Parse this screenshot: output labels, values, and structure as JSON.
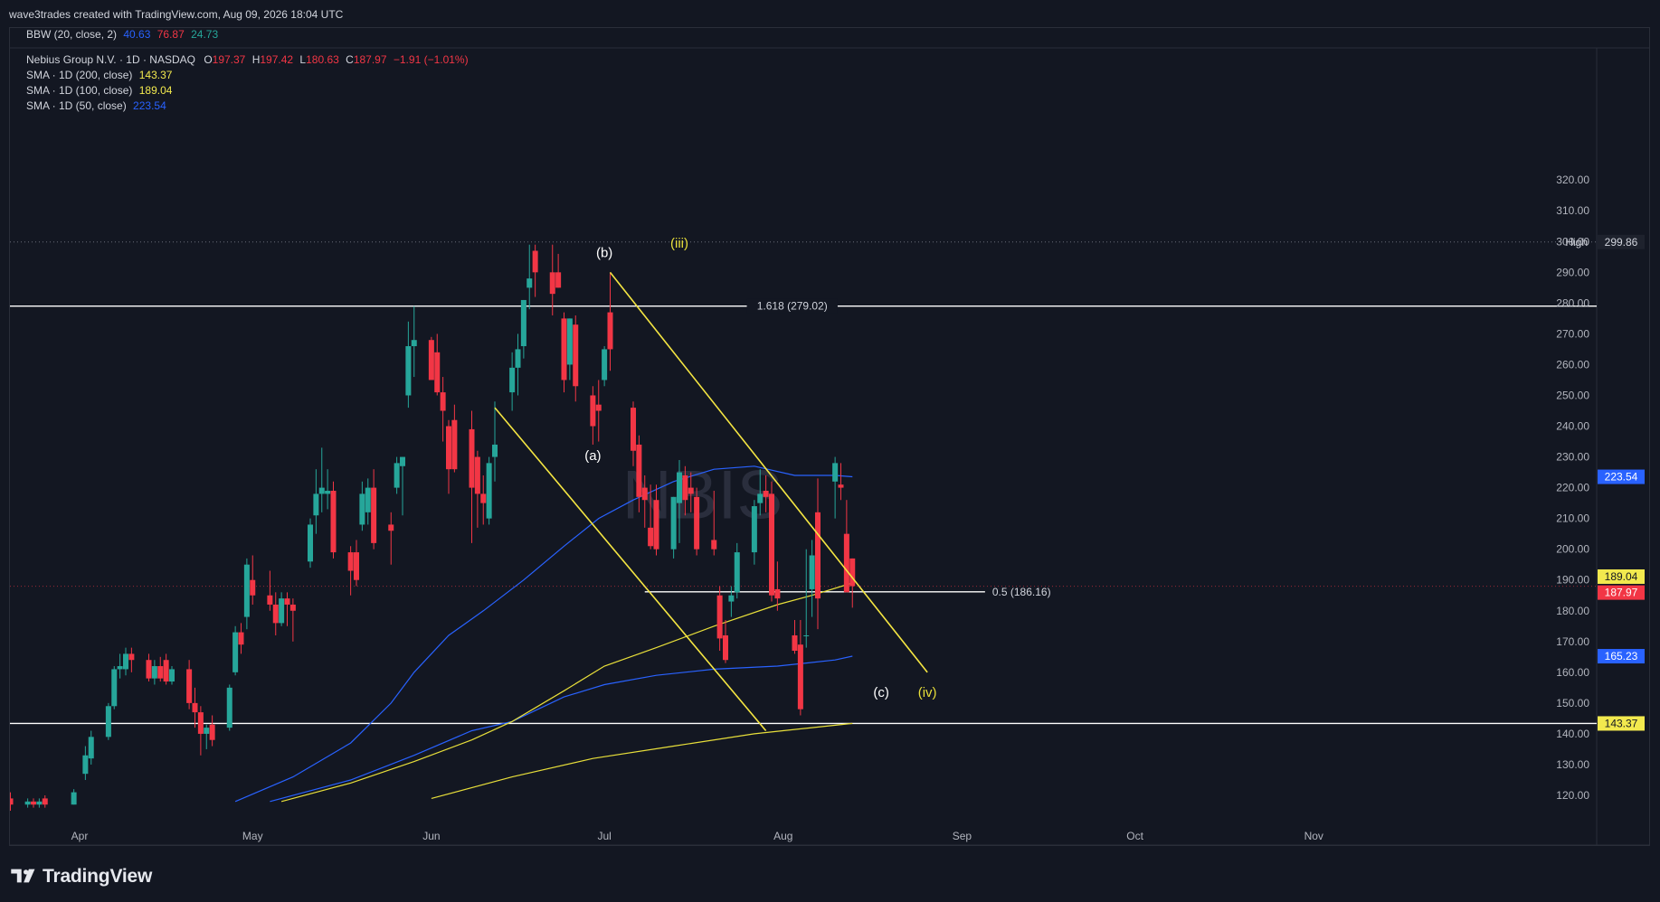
{
  "header": {
    "caption": "wave3trades created with TradingView.com, Aug 09, 2026 18:04 UTC"
  },
  "indicator_bbw": {
    "label": "BBW (20, close, 2)",
    "v1": "40.63",
    "v2": "76.87",
    "v3": "24.73"
  },
  "symbol": {
    "name": "Nebius Group N.V. · 1D · NASDAQ",
    "o_label": "O",
    "o": "197.37",
    "h_label": "H",
    "h": "197.42",
    "l_label": "L",
    "l": "180.63",
    "c_label": "C",
    "c": "187.97",
    "change": "−1.91 (−1.01%)",
    "watermark": "NBIS"
  },
  "sma_legend": [
    {
      "label": "SMA · 1D (200, close)",
      "value": "143.37",
      "color": "#f2e94e"
    },
    {
      "label": "SMA · 1D (100, close)",
      "value": "189.04",
      "color": "#f2e94e"
    },
    {
      "label": "SMA · 1D (50, close)",
      "value": "223.54",
      "color": "#2962ff"
    }
  ],
  "branding": {
    "name": "TradingView"
  },
  "colors": {
    "up": "#26a69a",
    "down": "#f23645",
    "background": "#131722",
    "sma_yellow": "#e8df3a",
    "sma_blue": "#2962ff",
    "channel": "#f5e642",
    "grid_text": "#b2b5be"
  },
  "chart_data": {
    "type": "candlestick",
    "y_range": [
      112,
      326
    ],
    "y_ticks": [
      "120.00",
      "130.00",
      "140.00",
      "150.00",
      "160.00",
      "170.00",
      "180.00",
      "190.00",
      "200.00",
      "210.00",
      "220.00",
      "230.00",
      "240.00",
      "250.00",
      "260.00",
      "270.00",
      "280.00",
      "290.00",
      "300.00",
      "310.00",
      "320.00"
    ],
    "x_labels": [
      {
        "label": "Apr",
        "date": "2026-04-01"
      },
      {
        "label": "May",
        "date": "2026-05-01"
      },
      {
        "label": "Jun",
        "date": "2026-06-01"
      },
      {
        "label": "Jul",
        "date": "2026-07-01"
      },
      {
        "label": "Aug",
        "date": "2026-08-01"
      },
      {
        "label": "Sep",
        "date": "2026-09-01"
      },
      {
        "label": "Oct",
        "date": "2026-10-01"
      },
      {
        "label": "Nov",
        "date": "2026-11-01"
      }
    ],
    "candles": [
      {
        "d": "2026-03-19",
        "o": 121,
        "h": 124,
        "l": 116,
        "c": 119
      },
      {
        "d": "2026-03-20",
        "o": 119,
        "h": 121,
        "l": 115,
        "c": 117
      },
      {
        "d": "2026-03-23",
        "o": 117,
        "h": 119,
        "l": 116,
        "c": 118
      },
      {
        "d": "2026-03-24",
        "o": 118,
        "h": 119,
        "l": 116,
        "c": 117
      },
      {
        "d": "2026-03-25",
        "o": 117,
        "h": 119,
        "l": 116,
        "c": 118
      },
      {
        "d": "2026-03-26",
        "o": 119,
        "h": 120,
        "l": 116,
        "c": 117
      },
      {
        "d": "2026-03-31",
        "o": 117,
        "h": 122,
        "l": 117,
        "c": 121
      },
      {
        "d": "2026-04-02",
        "o": 127,
        "h": 136,
        "l": 125,
        "c": 133
      },
      {
        "d": "2026-04-03",
        "o": 132,
        "h": 141,
        "l": 130,
        "c": 139
      },
      {
        "d": "2026-04-06",
        "o": 139,
        "h": 150,
        "l": 138,
        "c": 149
      },
      {
        "d": "2026-04-07",
        "o": 149,
        "h": 162,
        "l": 148,
        "c": 161
      },
      {
        "d": "2026-04-08",
        "o": 161,
        "h": 166,
        "l": 158,
        "c": 162
      },
      {
        "d": "2026-04-09",
        "o": 161,
        "h": 168,
        "l": 159,
        "c": 166
      },
      {
        "d": "2026-04-10",
        "o": 166,
        "h": 168,
        "l": 160,
        "c": 164
      },
      {
        "d": "2026-04-13",
        "o": 164,
        "h": 166,
        "l": 157,
        "c": 158
      },
      {
        "d": "2026-04-14",
        "o": 158,
        "h": 164,
        "l": 156,
        "c": 162
      },
      {
        "d": "2026-04-15",
        "o": 162,
        "h": 165,
        "l": 157,
        "c": 158
      },
      {
        "d": "2026-04-16",
        "o": 164,
        "h": 166,
        "l": 156,
        "c": 157
      },
      {
        "d": "2026-04-17",
        "o": 157,
        "h": 162,
        "l": 156,
        "c": 161
      },
      {
        "d": "2026-04-20",
        "o": 161,
        "h": 164,
        "l": 148,
        "c": 150
      },
      {
        "d": "2026-04-21",
        "o": 150,
        "h": 155,
        "l": 142,
        "c": 147
      },
      {
        "d": "2026-04-22",
        "o": 147,
        "h": 149,
        "l": 133,
        "c": 140
      },
      {
        "d": "2026-04-23",
        "o": 140,
        "h": 143,
        "l": 135,
        "c": 142
      },
      {
        "d": "2026-04-24",
        "o": 143,
        "h": 146,
        "l": 136,
        "c": 138
      },
      {
        "d": "2026-04-27",
        "o": 142,
        "h": 156,
        "l": 141,
        "c": 155
      },
      {
        "d": "2026-04-28",
        "o": 160,
        "h": 175,
        "l": 159,
        "c": 173
      },
      {
        "d": "2026-04-29",
        "o": 173,
        "h": 176,
        "l": 166,
        "c": 169
      },
      {
        "d": "2026-04-30",
        "o": 178,
        "h": 197,
        "l": 174,
        "c": 195
      },
      {
        "d": "2026-05-01",
        "o": 190,
        "h": 198,
        "l": 182,
        "c": 185
      },
      {
        "d": "2026-05-04",
        "o": 185,
        "h": 193,
        "l": 180,
        "c": 182
      },
      {
        "d": "2026-05-05",
        "o": 182,
        "h": 186,
        "l": 172,
        "c": 176
      },
      {
        "d": "2026-05-06",
        "o": 176,
        "h": 186,
        "l": 175,
        "c": 184
      },
      {
        "d": "2026-05-07",
        "o": 184,
        "h": 186,
        "l": 175,
        "c": 182
      },
      {
        "d": "2026-05-08",
        "o": 182,
        "h": 184,
        "l": 170,
        "c": 180
      },
      {
        "d": "2026-05-11",
        "o": 196,
        "h": 210,
        "l": 194,
        "c": 208
      },
      {
        "d": "2026-05-12",
        "o": 211,
        "h": 226,
        "l": 205,
        "c": 218
      },
      {
        "d": "2026-05-13",
        "o": 218,
        "h": 233,
        "l": 212,
        "c": 220
      },
      {
        "d": "2026-05-14",
        "o": 218,
        "h": 226,
        "l": 213,
        "c": 219
      },
      {
        "d": "2026-05-15",
        "o": 219,
        "h": 222,
        "l": 197,
        "c": 199
      },
      {
        "d": "2026-05-18",
        "o": 199,
        "h": 201,
        "l": 185,
        "c": 193
      },
      {
        "d": "2026-05-19",
        "o": 199,
        "h": 203,
        "l": 188,
        "c": 190
      },
      {
        "d": "2026-05-20",
        "o": 208,
        "h": 222,
        "l": 206,
        "c": 218
      },
      {
        "d": "2026-05-21",
        "o": 212,
        "h": 223,
        "l": 208,
        "c": 220
      },
      {
        "d": "2026-05-22",
        "o": 220,
        "h": 226,
        "l": 200,
        "c": 202
      },
      {
        "d": "2026-05-25",
        "o": 208,
        "h": 212,
        "l": 195,
        "c": 206
      },
      {
        "d": "2026-05-26",
        "o": 220,
        "h": 230,
        "l": 218,
        "c": 228
      },
      {
        "d": "2026-05-27",
        "o": 227,
        "h": 230,
        "l": 211,
        "c": 230
      },
      {
        "d": "2026-05-28",
        "o": 250,
        "h": 274,
        "l": 246,
        "c": 266
      },
      {
        "d": "2026-05-29",
        "o": 266,
        "h": 279,
        "l": 256,
        "c": 268
      },
      {
        "d": "2026-06-01",
        "o": 268,
        "h": 269,
        "l": 258,
        "c": 255
      },
      {
        "d": "2026-06-02",
        "o": 264,
        "h": 270,
        "l": 250,
        "c": 251
      },
      {
        "d": "2026-06-03",
        "o": 251,
        "h": 256,
        "l": 235,
        "c": 245
      },
      {
        "d": "2026-06-04",
        "o": 240,
        "h": 242,
        "l": 218,
        "c": 226
      },
      {
        "d": "2026-06-05",
        "o": 242,
        "h": 247,
        "l": 225,
        "c": 226
      },
      {
        "d": "2026-06-08",
        "o": 239,
        "h": 245,
        "l": 202,
        "c": 220
      },
      {
        "d": "2026-06-09",
        "o": 230,
        "h": 232,
        "l": 207,
        "c": 218
      },
      {
        "d": "2026-06-10",
        "o": 218,
        "h": 224,
        "l": 208,
        "c": 215
      },
      {
        "d": "2026-06-11",
        "o": 210,
        "h": 230,
        "l": 208,
        "c": 228
      },
      {
        "d": "2026-06-12",
        "o": 230,
        "h": 248,
        "l": 222,
        "c": 234
      },
      {
        "d": "2026-06-15",
        "o": 251,
        "h": 264,
        "l": 245,
        "c": 259
      },
      {
        "d": "2026-06-16",
        "o": 259,
        "h": 270,
        "l": 250,
        "c": 265
      },
      {
        "d": "2026-06-17",
        "o": 266,
        "h": 281,
        "l": 262,
        "c": 281
      },
      {
        "d": "2026-06-18",
        "o": 285,
        "h": 299,
        "l": 278,
        "c": 288
      },
      {
        "d": "2026-06-19",
        "o": 297,
        "h": 299,
        "l": 282,
        "c": 290
      },
      {
        "d": "2026-06-22",
        "o": 290,
        "h": 299,
        "l": 276,
        "c": 283
      },
      {
        "d": "2026-06-23",
        "o": 290,
        "h": 296,
        "l": 285,
        "c": 285
      },
      {
        "d": "2026-06-24",
        "o": 275,
        "h": 277,
        "l": 251,
        "c": 255
      },
      {
        "d": "2026-06-25",
        "o": 260,
        "h": 275,
        "l": 255,
        "c": 275
      },
      {
        "d": "2026-06-26",
        "o": 273,
        "h": 276,
        "l": 248,
        "c": 253
      },
      {
        "d": "2026-06-29",
        "o": 250,
        "h": 253,
        "l": 234,
        "c": 240
      },
      {
        "d": "2026-06-30",
        "o": 247,
        "h": 255,
        "l": 235,
        "c": 245
      },
      {
        "d": "2026-07-01",
        "o": 255,
        "h": 266,
        "l": 253,
        "c": 265
      },
      {
        "d": "2026-07-02",
        "o": 277,
        "h": 290,
        "l": 258,
        "c": 265
      },
      {
        "d": "2026-07-06",
        "o": 246,
        "h": 248,
        "l": 227,
        "c": 232
      },
      {
        "d": "2026-07-07",
        "o": 234,
        "h": 237,
        "l": 212,
        "c": 217
      },
      {
        "d": "2026-07-08",
        "o": 220,
        "h": 224,
        "l": 207,
        "c": 216
      },
      {
        "d": "2026-07-09",
        "o": 207,
        "h": 221,
        "l": 200,
        "c": 201
      },
      {
        "d": "2026-07-10",
        "o": 216,
        "h": 221,
        "l": 198,
        "c": 200
      },
      {
        "d": "2026-07-13",
        "o": 200,
        "h": 217,
        "l": 197,
        "c": 217
      },
      {
        "d": "2026-07-14",
        "o": 215,
        "h": 229,
        "l": 202,
        "c": 225
      },
      {
        "d": "2026-07-15",
        "o": 224,
        "h": 227,
        "l": 211,
        "c": 216
      },
      {
        "d": "2026-07-16",
        "o": 220,
        "h": 225,
        "l": 212,
        "c": 218
      },
      {
        "d": "2026-07-17",
        "o": 217,
        "h": 220,
        "l": 198,
        "c": 200
      },
      {
        "d": "2026-07-20",
        "o": 203,
        "h": 219,
        "l": 198,
        "c": 200
      },
      {
        "d": "2026-07-21",
        "o": 185,
        "h": 188,
        "l": 167,
        "c": 171
      },
      {
        "d": "2026-07-22",
        "o": 172,
        "h": 177,
        "l": 163,
        "c": 164
      },
      {
        "d": "2026-07-23",
        "o": 183,
        "h": 188,
        "l": 178,
        "c": 185
      },
      {
        "d": "2026-07-24",
        "o": 186,
        "h": 202,
        "l": 184,
        "c": 199
      },
      {
        "d": "2026-07-27",
        "o": 199,
        "h": 216,
        "l": 195,
        "c": 214
      },
      {
        "d": "2026-07-28",
        "o": 215,
        "h": 226,
        "l": 211,
        "c": 218
      },
      {
        "d": "2026-07-29",
        "o": 219,
        "h": 224,
        "l": 212,
        "c": 217
      },
      {
        "d": "2026-07-30",
        "o": 218,
        "h": 222,
        "l": 183,
        "c": 185
      },
      {
        "d": "2026-07-31",
        "o": 187,
        "h": 196,
        "l": 180,
        "c": 184
      },
      {
        "d": "2026-08-03",
        "o": 172,
        "h": 177,
        "l": 166,
        "c": 167
      },
      {
        "d": "2026-08-04",
        "o": 169,
        "h": 177,
        "l": 146,
        "c": 148
      },
      {
        "d": "2026-08-05",
        "o": 172,
        "h": 200,
        "l": 168,
        "c": 172
      },
      {
        "d": "2026-08-06",
        "o": 187,
        "h": 203,
        "l": 178,
        "c": 198
      },
      {
        "d": "2026-08-07",
        "o": 212,
        "h": 223,
        "l": 174,
        "c": 184
      },
      {
        "d": "2026-08-10",
        "o": 222,
        "h": 230,
        "l": 210,
        "c": 228
      },
      {
        "d": "2026-08-11",
        "o": 221,
        "h": 228,
        "l": 216,
        "c": 220
      },
      {
        "d": "2026-08-12",
        "o": 205,
        "h": 216,
        "l": 186,
        "c": 186
      },
      {
        "d": "2026-08-13",
        "o": 197,
        "h": 197,
        "l": 181,
        "c": 188
      }
    ],
    "sma50": [
      {
        "d": "2026-04-28",
        "v": 118
      },
      {
        "d": "2026-05-08",
        "v": 126
      },
      {
        "d": "2026-05-18",
        "v": 137
      },
      {
        "d": "2026-05-25",
        "v": 150
      },
      {
        "d": "2026-05-29",
        "v": 160
      },
      {
        "d": "2026-06-04",
        "v": 172
      },
      {
        "d": "2026-06-10",
        "v": 180
      },
      {
        "d": "2026-06-17",
        "v": 190
      },
      {
        "d": "2026-06-24",
        "v": 201
      },
      {
        "d": "2026-06-30",
        "v": 210
      },
      {
        "d": "2026-07-06",
        "v": 216
      },
      {
        "d": "2026-07-13",
        "v": 222
      },
      {
        "d": "2026-07-20",
        "v": 226
      },
      {
        "d": "2026-07-27",
        "v": 227
      },
      {
        "d": "2026-08-03",
        "v": 224
      },
      {
        "d": "2026-08-10",
        "v": 224
      },
      {
        "d": "2026-08-13",
        "v": 223.54
      }
    ],
    "sma100": [
      {
        "d": "2026-05-04",
        "v": 118
      },
      {
        "d": "2026-05-18",
        "v": 125
      },
      {
        "d": "2026-05-29",
        "v": 133
      },
      {
        "d": "2026-06-08",
        "v": 141
      },
      {
        "d": "2026-06-15",
        "v": 144
      },
      {
        "d": "2026-06-24",
        "v": 152
      },
      {
        "d": "2026-07-01",
        "v": 156
      },
      {
        "d": "2026-07-10",
        "v": 159
      },
      {
        "d": "2026-07-20",
        "v": 161
      },
      {
        "d": "2026-07-31",
        "v": 162
      },
      {
        "d": "2026-08-10",
        "v": 164
      },
      {
        "d": "2026-08-13",
        "v": 165.23
      }
    ],
    "sma200": [
      {
        "d": "2026-05-06",
        "v": 118
      },
      {
        "d": "2026-05-18",
        "v": 124
      },
      {
        "d": "2026-05-29",
        "v": 131
      },
      {
        "d": "2026-06-08",
        "v": 138
      },
      {
        "d": "2026-06-15",
        "v": 144
      },
      {
        "d": "2026-06-24",
        "v": 154
      },
      {
        "d": "2026-07-01",
        "v": 162
      },
      {
        "d": "2026-07-10",
        "v": 168
      },
      {
        "d": "2026-07-20",
        "v": 175
      },
      {
        "d": "2026-07-31",
        "v": 182
      },
      {
        "d": "2026-08-06",
        "v": 185
      },
      {
        "d": "2026-08-13",
        "v": 189.04
      }
    ],
    "sma_extra": [
      {
        "d": "2026-06-01",
        "v": 119
      },
      {
        "d": "2026-06-15",
        "v": 126
      },
      {
        "d": "2026-06-29",
        "v": 132
      },
      {
        "d": "2026-07-13",
        "v": 136
      },
      {
        "d": "2026-07-27",
        "v": 140
      },
      {
        "d": "2026-08-06",
        "v": 142
      },
      {
        "d": "2026-08-13",
        "v": 143.37
      }
    ],
    "horizontal_lines": [
      {
        "value": 279.02,
        "label": "1.618 (279.02)",
        "from": "2026-03-17",
        "to": "2026-12-31"
      },
      {
        "value": 186.16,
        "label": "0.5 (186.16)",
        "from": "2026-07-08",
        "to": "2026-09-05"
      },
      {
        "value": 143.37,
        "label": "",
        "from": "2026-03-17",
        "to": "2026-12-31"
      }
    ],
    "channel_lines": [
      {
        "from": {
          "d": "2026-07-02",
          "v": 290
        },
        "to": {
          "d": "2026-08-26",
          "v": 160
        }
      },
      {
        "from": {
          "d": "2026-06-12",
          "v": 246
        },
        "to": {
          "d": "2026-07-29",
          "v": 141
        }
      }
    ],
    "high_line": {
      "value": 299.86,
      "label": "High",
      "price": "299.86"
    },
    "annotations": [
      {
        "text": "(b)",
        "d": "2026-07-01",
        "v": 295,
        "color": "#ffffff"
      },
      {
        "text": "(iii)",
        "d": "2026-07-14",
        "v": 298,
        "color": "#e8df3a"
      },
      {
        "text": "(a)",
        "d": "2026-06-29",
        "v": 229,
        "color": "#ffffff"
      },
      {
        "text": "(c)",
        "d": "2026-08-18",
        "v": 152,
        "color": "#ffffff"
      },
      {
        "text": "(iv)",
        "d": "2026-08-26",
        "v": 152,
        "color": "#e8df3a"
      }
    ],
    "price_tags": [
      {
        "value": 223.54,
        "text": "223.54",
        "bg": "#2962ff",
        "fg": "#ffffff"
      },
      {
        "value": 189.04,
        "text": "189.04",
        "bg": "#f2e94e",
        "fg": "#131722"
      },
      {
        "value": 187.97,
        "text": "187.97",
        "bg": "#f23645",
        "fg": "#ffffff"
      },
      {
        "value": 165.23,
        "text": "165.23",
        "bg": "#2962ff",
        "fg": "#ffffff"
      },
      {
        "value": 143.37,
        "text": "143.37",
        "bg": "#f2e94e",
        "fg": "#131722"
      }
    ]
  }
}
